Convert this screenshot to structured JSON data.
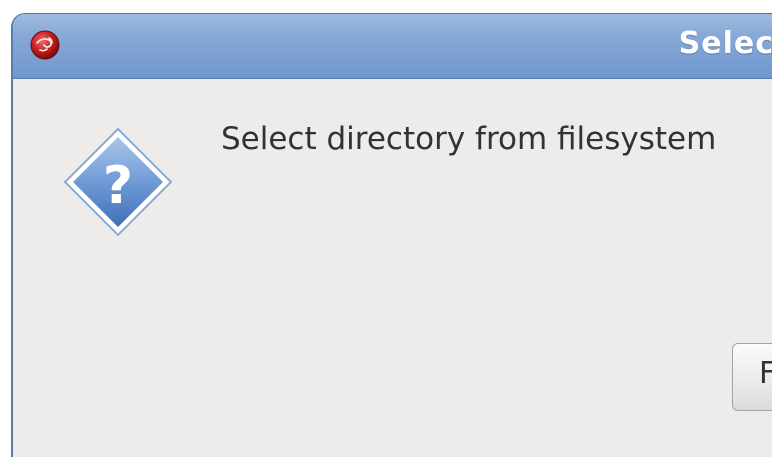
{
  "dialog": {
    "title": "Selec",
    "app_icon": "app-logo-icon",
    "message_icon": "question-icon",
    "message": "Select directory from filesystem",
    "button_label": "F"
  },
  "colors": {
    "titlebar": "#86a8d6",
    "body_bg": "#edeceb",
    "title_text": "#ffffff",
    "text": "#2e3436"
  }
}
